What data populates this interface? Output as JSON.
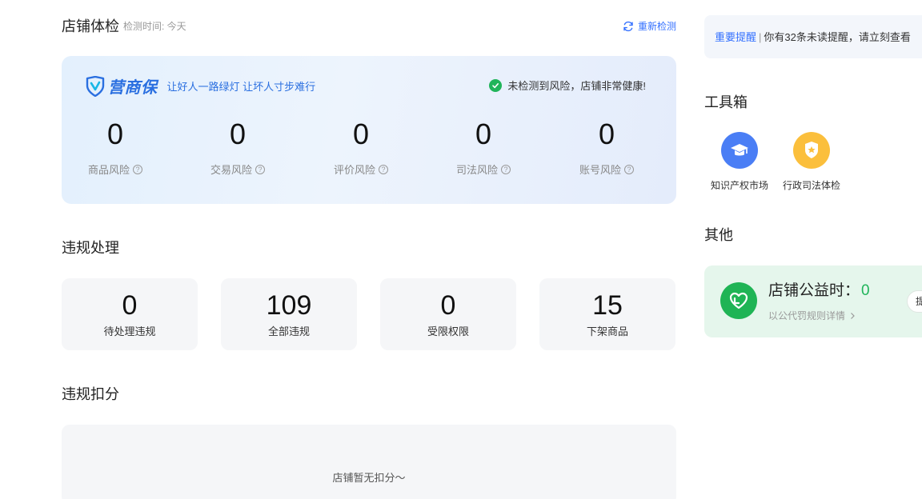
{
  "check": {
    "title": "店铺体检",
    "time": "检测时间: 今天",
    "recheck_label": "重新检测",
    "brand_logo": "营商保",
    "slogan": "让好人一路绿灯 让坏人寸步难行",
    "status": "未检测到风险，店铺非常健康!",
    "risks": [
      {
        "value": "0",
        "label": "商品风险"
      },
      {
        "value": "0",
        "label": "交易风险"
      },
      {
        "value": "0",
        "label": "评价风险"
      },
      {
        "value": "0",
        "label": "司法风险"
      },
      {
        "value": "0",
        "label": "账号风险"
      }
    ]
  },
  "violations": {
    "title": "违规处理",
    "items": [
      {
        "value": "0",
        "label": "待处理违规"
      },
      {
        "value": "109",
        "label": "全部违规"
      },
      {
        "value": "0",
        "label": "受限权限"
      },
      {
        "value": "15",
        "label": "下架商品"
      }
    ]
  },
  "deduction": {
    "title": "违规扣分",
    "empty_text": "店铺暂无扣分～"
  },
  "notice": {
    "link": "重要提醒",
    "text": "你有32条未读提醒，请立刻查看"
  },
  "toolbox": {
    "title": "工具箱",
    "items": [
      {
        "label": "知识产权市场",
        "icon": "graduation-cap-icon",
        "color": "#4a7ef5"
      },
      {
        "label": "行政司法体检",
        "icon": "shield-star-icon",
        "color": "#fbbf3c"
      }
    ]
  },
  "other": {
    "title": "其他",
    "welfare_label": "店铺公益时：",
    "welfare_value": "0",
    "welfare_sub": "以公代罚规则详情",
    "welfare_button": "提"
  },
  "colors": {
    "accent": "#3370ff",
    "success": "#20b45a"
  }
}
